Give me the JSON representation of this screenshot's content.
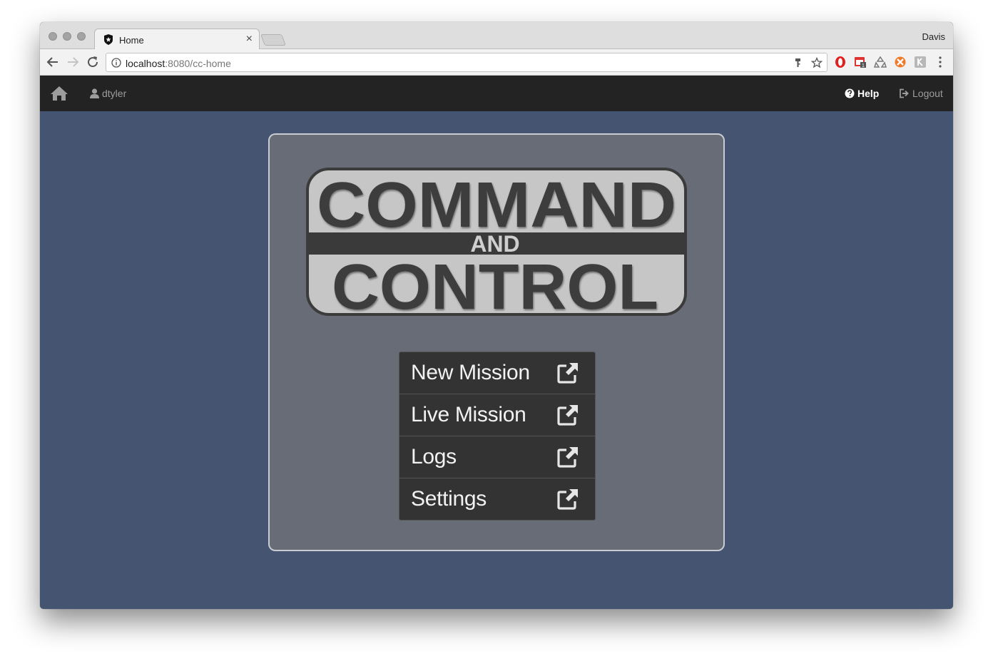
{
  "browser": {
    "tab_title": "Home",
    "tab_close": "×",
    "profile_name": "Davis",
    "url_host": "localhost",
    "url_rest": ":8080/cc-home"
  },
  "navbar": {
    "user": "dtyler",
    "help": "Help",
    "logout": "Logout"
  },
  "logo": {
    "line1": "COMMAND",
    "line2": "AND",
    "line3": "CONTROL"
  },
  "menu": {
    "items": [
      {
        "label": "New Mission",
        "icon": "external-link-icon"
      },
      {
        "label": "Live Mission",
        "icon": "external-link-icon"
      },
      {
        "label": "Logs",
        "icon": "external-link-icon"
      },
      {
        "label": "Settings",
        "icon": "external-link-icon"
      }
    ]
  },
  "colors": {
    "page_background": "#455470",
    "panel_background": "#676c76",
    "navbar": "#232323",
    "menu_button": "#333333"
  }
}
